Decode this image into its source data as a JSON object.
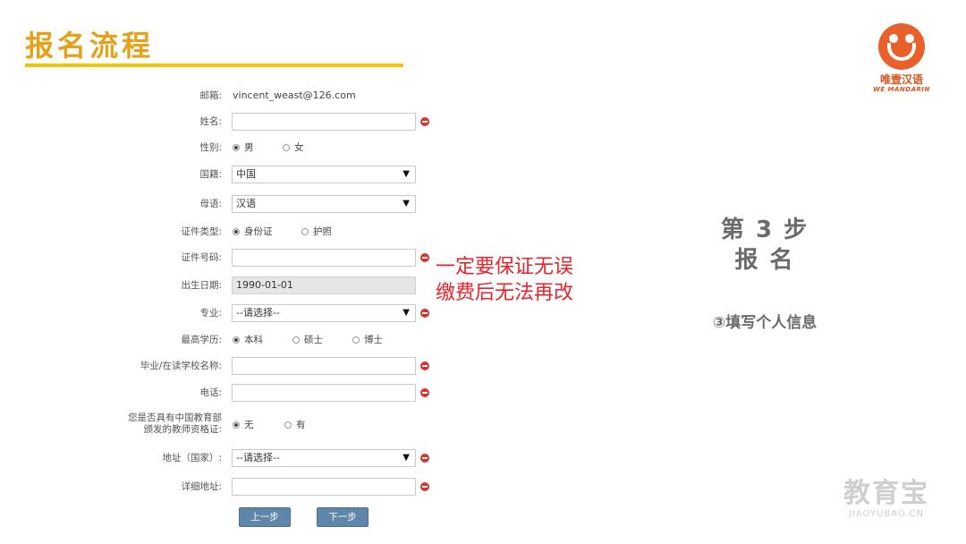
{
  "slide": {
    "title": "报名流程"
  },
  "logo": {
    "text": "唯壹汉语",
    "subtext": "WE MANDARIN"
  },
  "form": {
    "email": {
      "label": "邮箱:",
      "value": "vincent_weast@126.com"
    },
    "name": {
      "label": "姓名:",
      "value": ""
    },
    "gender": {
      "label": "性别:",
      "options": [
        "男",
        "女"
      ],
      "selected": "男"
    },
    "nationality": {
      "label": "国籍:",
      "value": "中国"
    },
    "native_language": {
      "label": "母语:",
      "value": "汉语"
    },
    "id_type": {
      "label": "证件类型:",
      "options": [
        "身份证",
        "护照"
      ],
      "selected": "身份证"
    },
    "id_number": {
      "label": "证件号码:",
      "value": ""
    },
    "birth_date": {
      "label": "出生日期:",
      "value": "1990-01-01"
    },
    "major": {
      "label": "专业:",
      "value": "--请选择--"
    },
    "education": {
      "label": "最高学历:",
      "options": [
        "本科",
        "硕士",
        "博士"
      ],
      "selected": "本科"
    },
    "school": {
      "label": "毕业/在读学校名称:",
      "value": ""
    },
    "phone": {
      "label": "电话:",
      "value": ""
    },
    "teacher_cert": {
      "label_line1": "您是否具有中国教育部",
      "label_line2": "颁发的教师资格证:",
      "options": [
        "无",
        "有"
      ],
      "selected": "无"
    },
    "address_country": {
      "label": "地址（国家）:",
      "value": "--请选择--"
    },
    "address_detail": {
      "label": "详细地址:",
      "value": ""
    },
    "prev_button": "上一步",
    "next_button": "下一步"
  },
  "warning": {
    "line1": "一定要保证无误",
    "line2": "缴费后无法再改"
  },
  "step": {
    "line1": "第 3 步",
    "line2": "报 名",
    "subtitle": "③填写个人信息"
  },
  "watermark": {
    "main": "教育宝",
    "sub": "JIAOYUBAO.CN"
  },
  "colors": {
    "title": "#e3a21a",
    "title_bar": "#f5c400",
    "warning": "#e8232a",
    "button": "#5d86a8",
    "required": "#d9342b"
  }
}
